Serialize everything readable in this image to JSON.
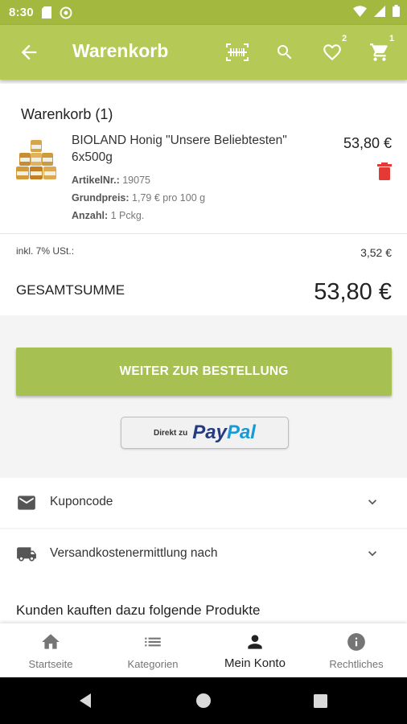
{
  "status_bar": {
    "time": "8:30"
  },
  "app_bar": {
    "title": "Warenkorb",
    "wishlist_badge": "2",
    "cart_badge": "1"
  },
  "cart": {
    "heading": "Warenkorb (1)",
    "item": {
      "name": "BIOLAND Honig \"Unsere Beliebtesten\" 6x500g",
      "price": "53,80 €",
      "article_label": "ArtikelNr.:",
      "article_value": "19075",
      "base_price_label": "Grundpreis:",
      "base_price_value": "1,79 € pro 100 g",
      "quantity_label": "Anzahl:",
      "quantity_value": "1 Pckg."
    },
    "tax_label": "inkl. 7% USt.:",
    "tax_value": "3,52 €",
    "total_label": "GESAMTSUMME",
    "total_value": "53,80 €"
  },
  "buttons": {
    "order": "WEITER ZUR BESTELLUNG",
    "paypal_prefix": "Direkt zu",
    "paypal_pay": "Pay",
    "paypal_pal": "Pal"
  },
  "sections": {
    "coupon": "Kuponcode",
    "shipping": "Versandkostenermittlung nach",
    "also_bought": "Kunden kauften dazu folgende Produkte"
  },
  "bottom_nav": [
    {
      "label": "Startseite",
      "icon": "home-icon"
    },
    {
      "label": "Kategorien",
      "icon": "list-icon"
    },
    {
      "label": "Mein Konto",
      "icon": "person-icon",
      "active": true
    },
    {
      "label": "Rechtliches",
      "icon": "info-icon"
    }
  ],
  "colors": {
    "app_bar": "#b5c956",
    "status_bar": "#a2b83e",
    "primary_button": "#a6c152",
    "delete": "#e53935",
    "paypal_dark": "#253b80",
    "paypal_light": "#179bd7"
  }
}
